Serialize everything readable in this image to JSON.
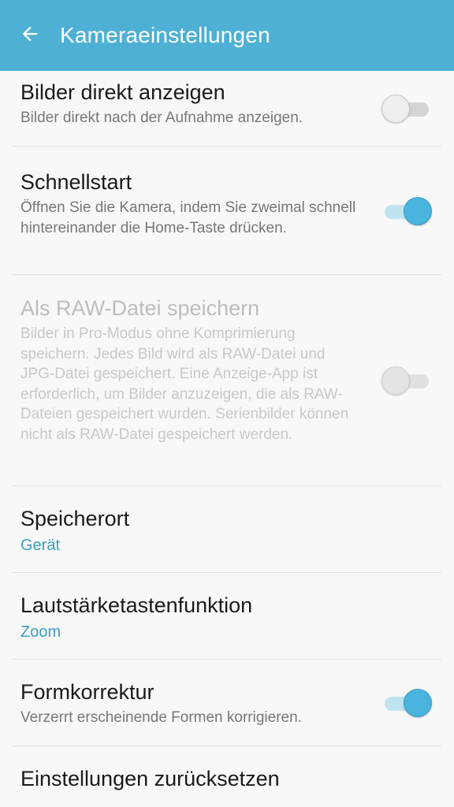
{
  "header": {
    "title": "Kameraeinstellungen",
    "back_icon": "arrow-left-icon"
  },
  "settings": [
    {
      "title": "Bilder direkt anzeigen",
      "description": "Bilder direkt nach der Aufnahme anzeigen.",
      "toggle": "off"
    },
    {
      "title": "Schnellstart",
      "description": "Öffnen Sie die Kamera, indem Sie zweimal schnell hintereinander die Home-Taste drücken.",
      "toggle": "on"
    },
    {
      "title": "Als RAW-Datei speichern",
      "description": "Bilder in Pro-Modus ohne Komprimierung speichern. Jedes Bild wird als RAW-Datei und JPG-Datei gespeichert. Eine Anzeige-App ist erforderlich, um Bilder anzuzeigen, die als RAW-Dateien gespeichert wurden. Serienbilder können nicht als RAW-Datei gespeichert werden.",
      "toggle": "off",
      "state": "disabled"
    },
    {
      "title": "Speicherort",
      "value": "Gerät"
    },
    {
      "title": "Lautstärketastenfunktion",
      "value": "Zoom"
    },
    {
      "title": "Formkorrektur",
      "description": "Verzerrt erscheinende Formen korrigieren.",
      "toggle": "on"
    },
    {
      "title": "Einstellungen zurücksetzen"
    }
  ],
  "colors": {
    "appbar": "#4eb0d4",
    "accent": "#3a9fc4",
    "toggle_on": "#4ab3de"
  }
}
